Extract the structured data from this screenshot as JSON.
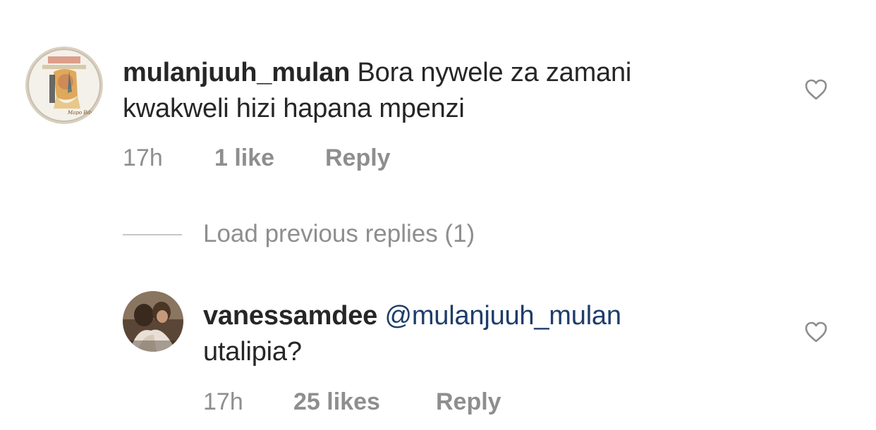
{
  "comments": [
    {
      "username": "mulanjuuh_mulan",
      "text_line1": "Bora nywele za zamani",
      "text_line2": "kwakweli hizi hapana mpenzi",
      "avatar_icon": "profile-avatar-illustration",
      "time": "17h",
      "likes": "1 like",
      "reply_label": "Reply",
      "like_icon": "heart-outline-icon"
    }
  ],
  "load_previous": {
    "label": "Load previous replies (1)"
  },
  "replies": [
    {
      "username": "vanessamdee",
      "mention": "@mulanjuuh_mulan",
      "text": "utalipia?",
      "avatar_icon": "profile-avatar-photo",
      "time": "17h",
      "likes": "25 likes",
      "reply_label": "Reply",
      "like_icon": "heart-outline-icon"
    }
  ],
  "colors": {
    "text": "#262626",
    "secondary": "#8e8e8e",
    "mention": "#1e3d6b",
    "divider": "#c7c7c7"
  }
}
